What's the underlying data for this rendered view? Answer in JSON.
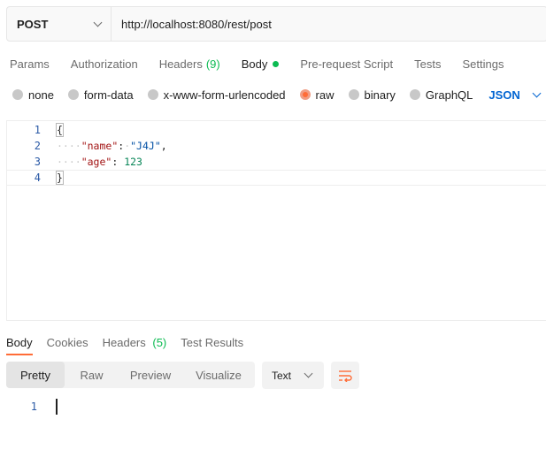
{
  "request": {
    "method": "POST",
    "url": "http://localhost:8080/rest/post"
  },
  "request_tabs": {
    "params": "Params",
    "authorization": "Authorization",
    "headers": "Headers",
    "headers_count": "(9)",
    "body": "Body",
    "prerequest": "Pre-request Script",
    "tests": "Tests",
    "settings": "Settings"
  },
  "body_types": {
    "none": "none",
    "form_data": "form-data",
    "urlencoded": "x-www-form-urlencoded",
    "raw": "raw",
    "binary": "binary",
    "graphql": "GraphQL",
    "format": "JSON",
    "selected": "raw"
  },
  "editor": {
    "line_numbers": [
      "1",
      "2",
      "3",
      "4"
    ],
    "open_brace": "{",
    "close_brace": "}",
    "indent": "····",
    "key1": "\"name\"",
    "colon1": ":",
    "space1": "·",
    "value1": "\"J4J\"",
    "comma1": ",",
    "key2": "\"age\"",
    "colon2": ":",
    "space2": " ",
    "value2": "123"
  },
  "response_tabs": {
    "body": "Body",
    "cookies": "Cookies",
    "headers": "Headers",
    "headers_count": "(5)",
    "test_results": "Test Results"
  },
  "response_view": {
    "pretty": "Pretty",
    "raw": "Raw",
    "preview": "Preview",
    "visualize": "Visualize",
    "format": "Text",
    "line_number": "1"
  },
  "colors": {
    "accent": "#ff6c37",
    "link_blue": "#0265d2",
    "count_green": "#0cbb52"
  },
  "icons": {
    "method_dropdown": "chevron-down-icon",
    "format_dropdown": "chevron-down-icon",
    "wrap": "wrap-lines-icon"
  }
}
